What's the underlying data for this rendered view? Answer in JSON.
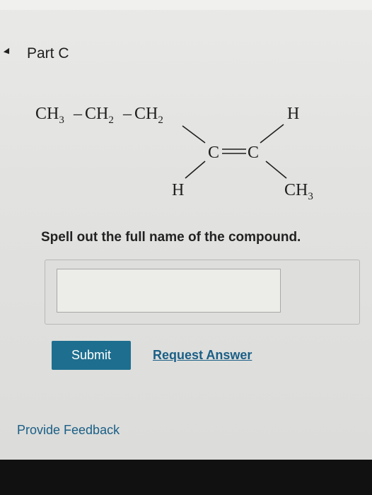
{
  "part": {
    "title": "Part C"
  },
  "molecule": {
    "ch3_c": "CH",
    "ch3_sub": "3",
    "ch2a_c": "CH",
    "ch2a_sub": "2",
    "ch2b_c": "CH",
    "ch2b_sub": "2",
    "dash": "–",
    "h_top": "H",
    "c_left": "C",
    "c_right": "C",
    "h_bottom": "H",
    "ch3b_c": "CH",
    "ch3b_sub": "3"
  },
  "question": {
    "text": "Spell out the full name of the compound."
  },
  "answer": {
    "value": ""
  },
  "actions": {
    "submit_label": "Submit",
    "request_label": "Request Answer"
  },
  "footer": {
    "feedback_label": "Provide Feedback"
  }
}
